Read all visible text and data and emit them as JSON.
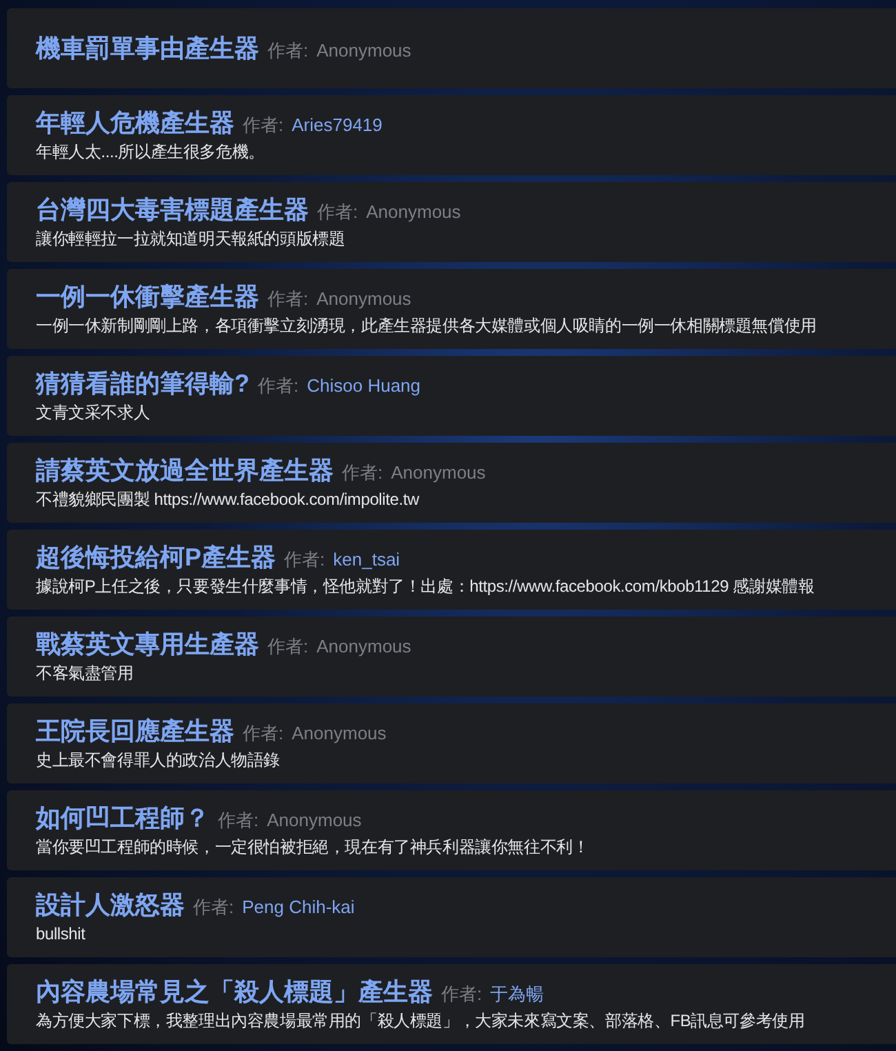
{
  "generators": [
    {
      "title": "機車罰單事由產生器",
      "author_label": "作者:",
      "author": "Anonymous",
      "linked": false
    },
    {
      "title": "年輕人危機產生器",
      "author_label": "作者:",
      "author": "Aries79419",
      "linked": true,
      "description": "年輕人太....所以產生很多危機。"
    },
    {
      "title": "台灣四大毒害標題產生器",
      "author_label": "作者:",
      "author": "Anonymous",
      "linked": false,
      "description": "讓你輕輕拉一拉就知道明天報紙的頭版標題"
    },
    {
      "title": "一例一休衝擊產生器",
      "author_label": "作者:",
      "author": "Anonymous",
      "linked": false,
      "description": "一例一休新制剛剛上路，各項衝擊立刻湧現，此產生器提供各大媒體或個人吸睛的一例一休相關標題無償使用"
    },
    {
      "title": "猜猜看誰的筆得輸?",
      "author_label": "作者:",
      "author": "Chisoo Huang",
      "linked": true,
      "description": "文青文采不求人"
    },
    {
      "title": "請蔡英文放過全世界產生器",
      "author_label": "作者:",
      "author": "Anonymous",
      "linked": false,
      "description": "不禮貌鄉民團製 https://www.facebook.com/impolite.tw"
    },
    {
      "title": "超後悔投給柯P產生器",
      "author_label": "作者:",
      "author": "ken_tsai",
      "linked": true,
      "description": "據說柯P上任之後，只要發生什麼事情，怪他就對了！出處：https://www.facebook.com/kbob1129 感謝媒體報"
    },
    {
      "title": "戰蔡英文專用生產器",
      "author_label": "作者:",
      "author": "Anonymous",
      "linked": false,
      "description": "不客氣盡管用"
    },
    {
      "title": "王院長回應產生器",
      "author_label": "作者:",
      "author": "Anonymous",
      "linked": false,
      "description": "史上最不會得罪人的政治人物語錄"
    },
    {
      "title": "如何凹工程師？",
      "author_label": "作者:",
      "author": "Anonymous",
      "linked": false,
      "description": "當你要凹工程師的時候，一定很怕被拒絕，現在有了神兵利器讓你無往不利！"
    },
    {
      "title": "設計人激怒器",
      "author_label": "作者:",
      "author": "Peng Chih-kai",
      "linked": true,
      "description": "bullshit"
    },
    {
      "title": "內容農場常見之「殺人標題」產生器",
      "author_label": "作者:",
      "author": "于為暢",
      "linked": true,
      "description": "為方便大家下標，我整理出內容農場最常用的「殺人標題」，大家未來寫文案、部落格、FB訊息可參考使用"
    }
  ]
}
